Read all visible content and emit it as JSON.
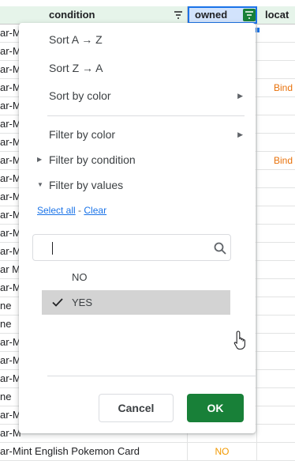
{
  "header": {
    "condition": "condition",
    "owned": "owned",
    "location": "locat"
  },
  "rows": [
    {
      "condition": "ar-M",
      "owned": "",
      "location": ""
    },
    {
      "condition": "ar-M",
      "owned": "",
      "location": ""
    },
    {
      "condition": "ar-M",
      "owned": "",
      "location": ""
    },
    {
      "condition": "ar-M",
      "owned": "",
      "location": "Bind"
    },
    {
      "condition": "ar-M",
      "owned": "",
      "location": ""
    },
    {
      "condition": "ar-M",
      "owned": "",
      "location": ""
    },
    {
      "condition": "ar-M",
      "owned": "",
      "location": ""
    },
    {
      "condition": "ar-M",
      "owned": "",
      "location": "Bind"
    },
    {
      "condition": "ar-M",
      "owned": "",
      "location": ""
    },
    {
      "condition": "ar-M",
      "owned": "",
      "location": ""
    },
    {
      "condition": "ar-M",
      "owned": "",
      "location": ""
    },
    {
      "condition": "ar-M",
      "owned": "",
      "location": ""
    },
    {
      "condition": "ar-M",
      "owned": "",
      "location": ""
    },
    {
      "condition": "ar M",
      "owned": "",
      "location": ""
    },
    {
      "condition": "ar-M",
      "owned": "",
      "location": ""
    },
    {
      "condition": "ne",
      "owned": "",
      "location": ""
    },
    {
      "condition": "ne",
      "owned": "",
      "location": ""
    },
    {
      "condition": "ar-M",
      "owned": "",
      "location": ""
    },
    {
      "condition": "ar-M",
      "owned": "",
      "location": ""
    },
    {
      "condition": "ar-M",
      "owned": "",
      "location": ""
    },
    {
      "condition": "ne",
      "owned": "",
      "location": ""
    },
    {
      "condition": "ar-M",
      "owned": "",
      "location": ""
    },
    {
      "condition": "ar-M",
      "owned": "",
      "location": ""
    },
    {
      "condition": "ar-Mint English Pokemon Card",
      "owned": "NO",
      "location": ""
    }
  ],
  "menu": {
    "sort_az": "Sort A → Z",
    "sort_za": "Sort Z → A",
    "sort_color": "Sort by color",
    "filter_color": "Filter by color",
    "filter_condition": "Filter by condition",
    "filter_values": "Filter by values",
    "select_all": "Select all",
    "separator": "-",
    "clear": "Clear",
    "search_value": "",
    "values": [
      {
        "label": "NO",
        "checked": false
      },
      {
        "label": "YES",
        "checked": true
      }
    ],
    "cancel": "Cancel",
    "ok": "OK"
  },
  "colors": {
    "header_bg": "#e6f4ea",
    "accent_green": "#188038",
    "selection_blue": "#1a73e8",
    "link_blue": "#1a73e8",
    "location_text": "#e8710a",
    "owned_text": "#f29900"
  },
  "icons": {
    "filter": "filter-icon",
    "search": "search-icon",
    "check": "check-icon",
    "submenu": "chevron-right-icon",
    "expand": "triangle-down-icon",
    "collapse": "triangle-right-icon",
    "cursor": "hand-pointer-icon"
  }
}
